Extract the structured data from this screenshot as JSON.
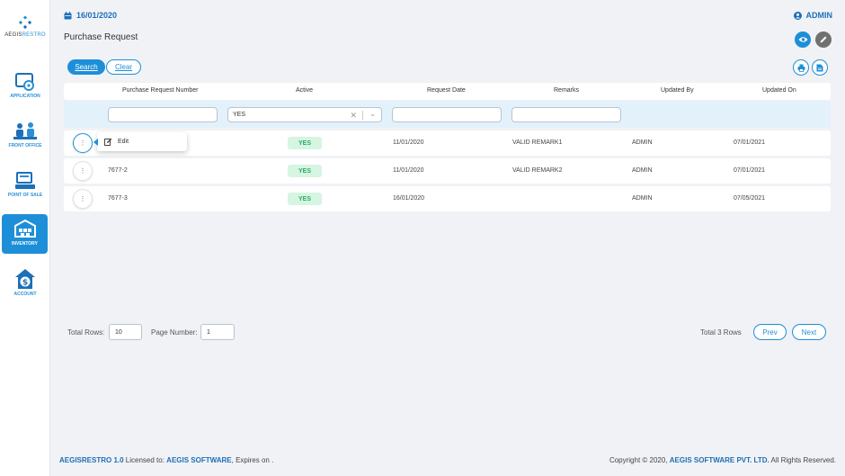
{
  "app": {
    "logo_text_a": "AEGIS",
    "logo_text_b": "RESTRO",
    "accent_color": "#1d8fd8"
  },
  "sidebar": {
    "items": [
      {
        "label": "APPLICATION",
        "icon": "application-gear-icon"
      },
      {
        "label": "FRONT OFFICE",
        "icon": "front-office-people-icon"
      },
      {
        "label": "POINT OF SALE",
        "icon": "pos-terminal-icon"
      },
      {
        "label": "INVENTORY",
        "icon": "inventory-warehouse-icon",
        "active": true
      },
      {
        "label": "ACCOUNT",
        "icon": "account-dollar-icon"
      }
    ]
  },
  "header": {
    "date": "16/01/2020",
    "user": "ADMIN",
    "page_title": "Purchase Request"
  },
  "toolbar": {
    "search_label": "Search",
    "clear_label": "Clear"
  },
  "table": {
    "columns": [
      "Purchase Request Number",
      "Active",
      "Request Date",
      "Remarks",
      "Updated By",
      "Updated On"
    ],
    "filters": {
      "number": "",
      "active": "YES",
      "request_date": "",
      "remarks": ""
    },
    "rows": [
      {
        "number": "",
        "active": "YES",
        "request_date": "11/01/2020",
        "remarks": "VALID REMARK1",
        "updated_by": "ADMIN",
        "updated_on": "07/01/2021"
      },
      {
        "number": "7677-2",
        "active": "YES",
        "request_date": "11/01/2020",
        "remarks": "VALID REMARK2",
        "updated_by": "ADMIN",
        "updated_on": "07/01/2021"
      },
      {
        "number": "7677-3",
        "active": "YES",
        "request_date": "16/01/2020",
        "remarks": "",
        "updated_by": "ADMIN",
        "updated_on": "07/05/2021"
      }
    ],
    "row_menu_dots": "⋮",
    "context_menu": {
      "edit_label": "Edit"
    }
  },
  "pagination": {
    "total_rows_label": "Total Rows:",
    "total_rows_value": "10",
    "page_number_label": "Page Number:",
    "page_number_value": "1",
    "total_text": "Total 3 Rows",
    "prev_label": "Prev",
    "next_label": "Next"
  },
  "footer": {
    "product": "AEGISRESTRO 1.0",
    "licensed_text": " Licensed to: ",
    "licensee": "AEGIS SOFTWARE",
    "expires_text": ", Expires on .",
    "copyright_text": "Copyright © 2020, ",
    "company": "AEGIS SOFTWARE PVT. LTD.",
    "rights_text": " All Rights Reserved."
  }
}
